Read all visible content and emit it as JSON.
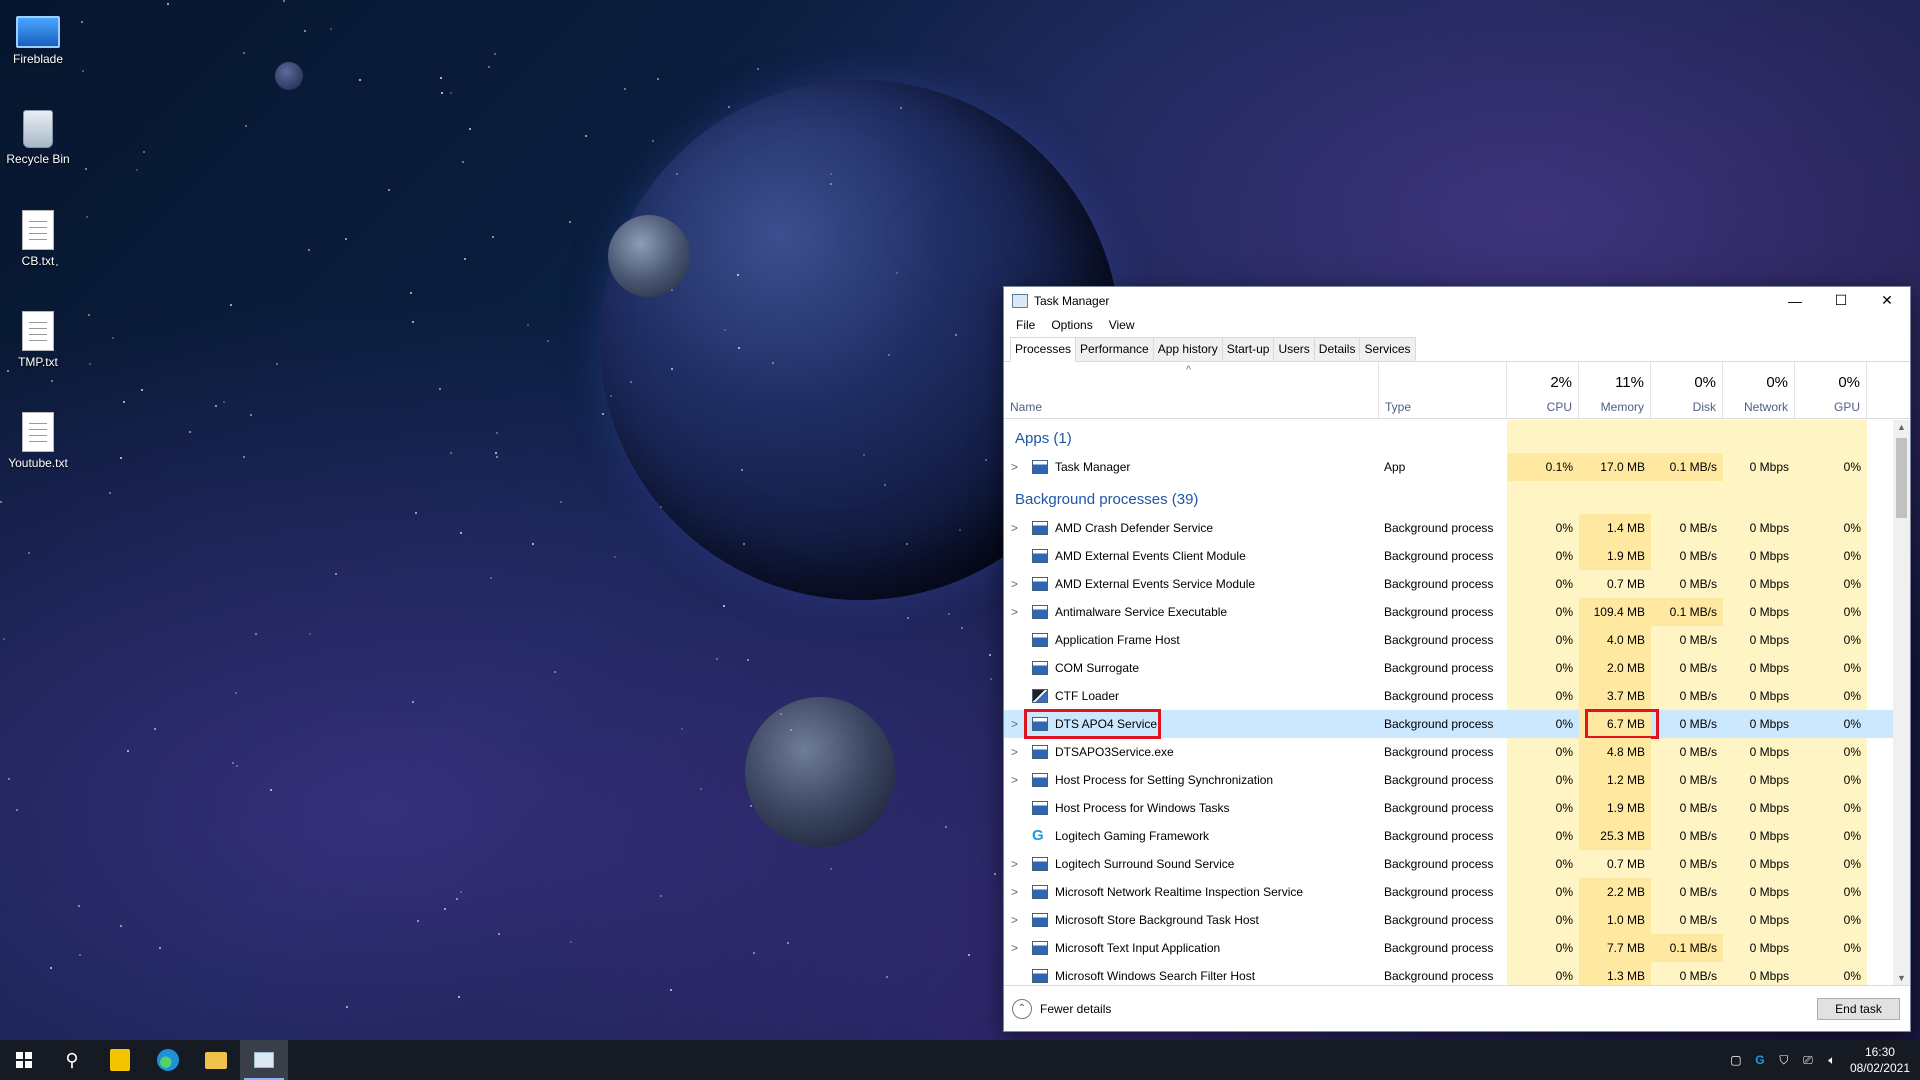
{
  "desktop": {
    "icons": [
      {
        "label": "Fireblade",
        "icon": "computer-icon"
      },
      {
        "label": "Recycle Bin",
        "icon": "recycle-bin-icon"
      },
      {
        "label": "CB.txt",
        "icon": "text-file-icon"
      },
      {
        "label": "TMP.txt",
        "icon": "text-file-icon"
      },
      {
        "label": "Youtube.txt",
        "icon": "text-file-icon"
      }
    ]
  },
  "window": {
    "title": "Task Manager",
    "minimize": "—",
    "maximize": "☐",
    "close": "✕"
  },
  "menu": {
    "file": "File",
    "options": "Options",
    "view": "View"
  },
  "tabs": [
    "Processes",
    "Performance",
    "App history",
    "Start-up",
    "Users",
    "Details",
    "Services"
  ],
  "columns": {
    "sort_caret": "^",
    "name": "Name",
    "type": "Type",
    "cpu": {
      "pct": "2%",
      "label": "CPU"
    },
    "memory": {
      "pct": "11%",
      "label": "Memory"
    },
    "disk": {
      "pct": "0%",
      "label": "Disk"
    },
    "network": {
      "pct": "0%",
      "label": "Network"
    },
    "gpu": {
      "pct": "0%",
      "label": "GPU"
    }
  },
  "groups": {
    "apps": "Apps (1)",
    "background": "Background processes (39)"
  },
  "apps": [
    {
      "name": "Task Manager",
      "type": "App",
      "cpu": "0.1%",
      "memory": "17.0 MB",
      "disk": "0.1 MB/s",
      "network": "0 Mbps",
      "gpu": "0%",
      "expand": ">",
      "icon": "task-manager-icon"
    }
  ],
  "processes": [
    {
      "name": "AMD Crash Defender Service",
      "type": "Background process",
      "cpu": "0%",
      "memory": "1.4 MB",
      "disk": "0 MB/s",
      "network": "0 Mbps",
      "gpu": "0%",
      "expand": ">"
    },
    {
      "name": "AMD External Events Client Module",
      "type": "Background process",
      "cpu": "0%",
      "memory": "1.9 MB",
      "disk": "0 MB/s",
      "network": "0 Mbps",
      "gpu": "0%",
      "expand": ""
    },
    {
      "name": "AMD External Events Service Module",
      "type": "Background process",
      "cpu": "0%",
      "memory": "0.7 MB",
      "disk": "0 MB/s",
      "network": "0 Mbps",
      "gpu": "0%",
      "expand": ">"
    },
    {
      "name": "Antimalware Service Executable",
      "type": "Background process",
      "cpu": "0%",
      "memory": "109.4 MB",
      "disk": "0.1 MB/s",
      "network": "0 Mbps",
      "gpu": "0%",
      "expand": ">"
    },
    {
      "name": "Application Frame Host",
      "type": "Background process",
      "cpu": "0%",
      "memory": "4.0 MB",
      "disk": "0 MB/s",
      "network": "0 Mbps",
      "gpu": "0%",
      "expand": ""
    },
    {
      "name": "COM Surrogate",
      "type": "Background process",
      "cpu": "0%",
      "memory": "2.0 MB",
      "disk": "0 MB/s",
      "network": "0 Mbps",
      "gpu": "0%",
      "expand": ""
    },
    {
      "name": "CTF Loader",
      "type": "Background process",
      "cpu": "0%",
      "memory": "3.7 MB",
      "disk": "0 MB/s",
      "network": "0 Mbps",
      "gpu": "0%",
      "expand": ""
    },
    {
      "name": "DTS APO4 Service",
      "type": "Background process",
      "cpu": "0%",
      "memory": "6.7 MB",
      "disk": "0 MB/s",
      "network": "0 Mbps",
      "gpu": "0%",
      "expand": ">"
    },
    {
      "name": "DTSAPO3Service.exe",
      "type": "Background process",
      "cpu": "0%",
      "memory": "4.8 MB",
      "disk": "0 MB/s",
      "network": "0 Mbps",
      "gpu": "0%",
      "expand": ">"
    },
    {
      "name": "Host Process for Setting Synchronization",
      "type": "Background process",
      "cpu": "0%",
      "memory": "1.2 MB",
      "disk": "0 MB/s",
      "network": "0 Mbps",
      "gpu": "0%",
      "expand": ">"
    },
    {
      "name": "Host Process for Windows Tasks",
      "type": "Background process",
      "cpu": "0%",
      "memory": "1.9 MB",
      "disk": "0 MB/s",
      "network": "0 Mbps",
      "gpu": "0%",
      "expand": ""
    },
    {
      "name": "Logitech Gaming Framework",
      "type": "Background process",
      "cpu": "0%",
      "memory": "25.3 MB",
      "disk": "0 MB/s",
      "network": "0 Mbps",
      "gpu": "0%",
      "expand": ""
    },
    {
      "name": "Logitech Surround Sound Service",
      "type": "Background process",
      "cpu": "0%",
      "memory": "0.7 MB",
      "disk": "0 MB/s",
      "network": "0 Mbps",
      "gpu": "0%",
      "expand": ">"
    },
    {
      "name": "Microsoft Network Realtime Inspection Service",
      "type": "Background process",
      "cpu": "0%",
      "memory": "2.2 MB",
      "disk": "0 MB/s",
      "network": "0 Mbps",
      "gpu": "0%",
      "expand": ">"
    },
    {
      "name": "Microsoft Store Background Task Host",
      "type": "Background process",
      "cpu": "0%",
      "memory": "1.0 MB",
      "disk": "0 MB/s",
      "network": "0 Mbps",
      "gpu": "0%",
      "expand": ">"
    },
    {
      "name": "Microsoft Text Input Application",
      "type": "Background process",
      "cpu": "0%",
      "memory": "7.7 MB",
      "disk": "0.1 MB/s",
      "network": "0 Mbps",
      "gpu": "0%",
      "expand": ">"
    },
    {
      "name": "Microsoft Windows Search Filter Host",
      "type": "Background process",
      "cpu": "0%",
      "memory": "1.3 MB",
      "disk": "0 MB/s",
      "network": "0 Mbps",
      "gpu": "0%",
      "expand": ""
    }
  ],
  "footer": {
    "fewer_details": "Fewer details",
    "end_task": "End task"
  },
  "taskbar": {
    "time": "16:30",
    "date": "08/02/2021"
  },
  "colors": {
    "heat": "#fff4c4",
    "heat_high": "#ffe8a0",
    "selected": "#cce8ff",
    "group_text": "#1e56a8",
    "highlight_box": "#e0141e"
  }
}
